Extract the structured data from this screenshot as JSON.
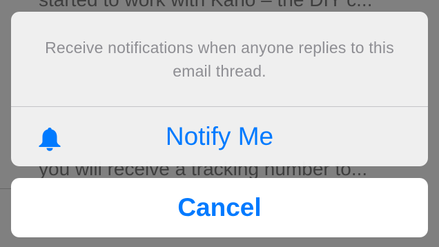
{
  "background": {
    "line_top": "started to work with Kano – the DIY c...",
    "line_mid": "you will receive a tracking number to..."
  },
  "action_sheet": {
    "message": "Receive notifications when anyone replies to this email thread.",
    "actions": [
      {
        "label": "Notify Me",
        "icon": "bell-icon"
      }
    ],
    "cancel_label": "Cancel"
  },
  "colors": {
    "accent": "#007aff",
    "message_text": "#8e8e93",
    "dim_overlay": "#808080"
  }
}
